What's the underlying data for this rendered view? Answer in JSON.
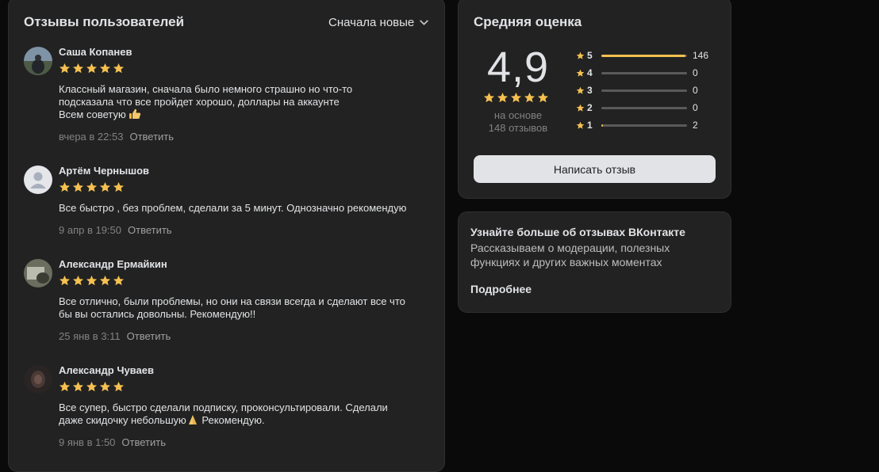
{
  "reviews_panel": {
    "title": "Отзывы пользователей",
    "sort_label": "Сначала новые",
    "items": [
      {
        "author": "Саша Копанев",
        "rating": 5,
        "text_lines": [
          "Классный магазин, сначала было немного страшно но что-то",
          "подсказала что все пройдет хорошо, доллары на аккаунте",
          "Всем советую"
        ],
        "emoji": "thumbs-up-icon",
        "date": "вчера в 22:53",
        "reply_label": "Ответить"
      },
      {
        "author": "Артём Чернышов",
        "rating": 5,
        "text_lines": [
          "Все быстро , без проблем, сделали за 5 минут. Однозначно рекомендую"
        ],
        "date": "9 апр в 19:50",
        "reply_label": "Ответить"
      },
      {
        "author": "Александр Ермайкин",
        "rating": 5,
        "text_lines": [
          "Все отлично, были проблемы, но они на связи всегда и сделают все что",
          "бы вы остались довольны. Рекомендую!!"
        ],
        "date": "25 янв в 3:11",
        "reply_label": "Ответить"
      },
      {
        "author": "Александр Чуваев",
        "rating": 5,
        "text_lines": [
          "Все супер, быстро сделали подписку, проконсультировали. Сделали",
          "даже скидочку небольшую",
          "Рекомендую."
        ],
        "emoji": "praying-hands-icon",
        "date": "9 янв в 1:50",
        "reply_label": "Ответить"
      }
    ]
  },
  "rating_panel": {
    "title": "Средняя оценка",
    "average": "4,9",
    "average_value": 4.9,
    "based_on_line1": "на основе",
    "based_on_line2": "148 отзывов",
    "distribution": [
      {
        "stars": "5",
        "count": "146",
        "fraction": 0.986
      },
      {
        "stars": "4",
        "count": "0",
        "fraction": 0
      },
      {
        "stars": "3",
        "count": "0",
        "fraction": 0
      },
      {
        "stars": "2",
        "count": "0",
        "fraction": 0
      },
      {
        "stars": "1",
        "count": "2",
        "fraction": 0.014
      }
    ],
    "write_button": "Написать отзыв"
  },
  "learn_panel": {
    "title": "Узнайте больше об отзывах ВКонтакте",
    "description": "Рассказываем о модерации, полезных функциях и других важных моментах",
    "more_link": "Подробнее"
  },
  "colors": {
    "star": "#f5c04f",
    "bar_fill": "#f5c04f",
    "bar_track": "#5a5a5a",
    "panel_bg": "#222222",
    "page_bg": "#0a0a0a"
  }
}
